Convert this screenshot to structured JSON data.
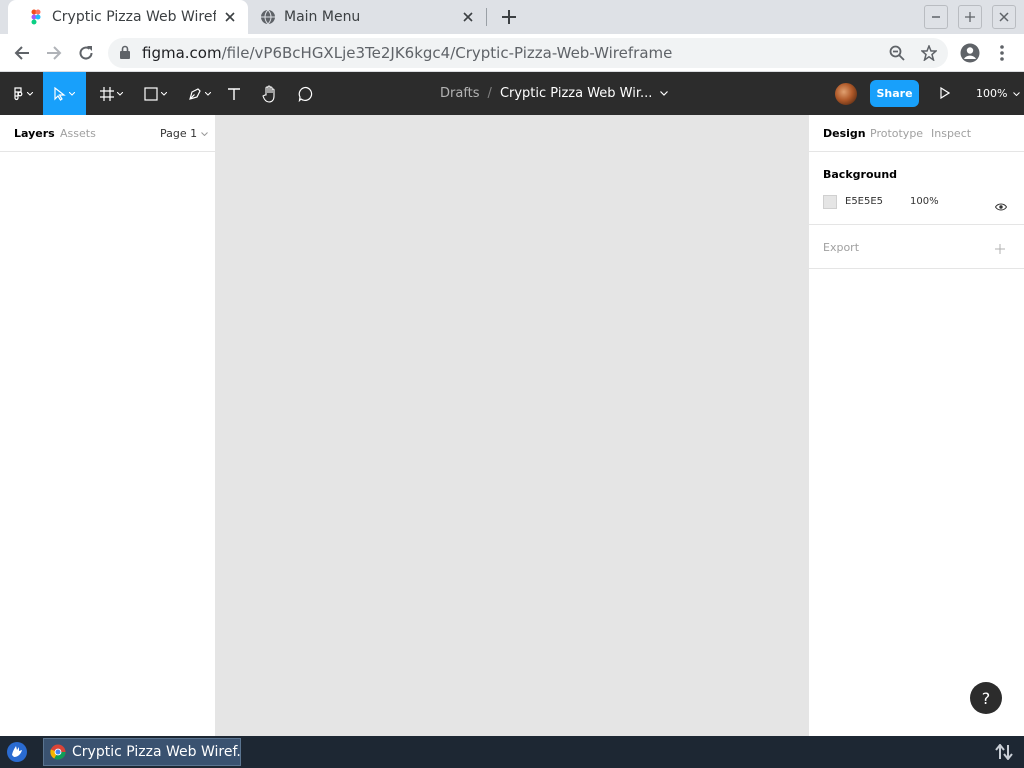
{
  "browser": {
    "tabs": [
      {
        "title": "Cryptic Pizza Web Wireframe",
        "favicon": "figma-icon",
        "active": true
      },
      {
        "title": "Main Menu",
        "favicon": "globe-icon",
        "active": false
      }
    ],
    "url_domain": "figma.com",
    "url_path": "/file/vP6BcHGXLje3Te2JK6kgc4/Cryptic-Pizza-Web-Wireframe"
  },
  "figma": {
    "breadcrumb": {
      "folder": "Drafts",
      "separator": "/",
      "file": "Cryptic Pizza Web Wir..."
    },
    "share_label": "Share",
    "zoom": "100%",
    "left_panel": {
      "tabs": [
        "Layers",
        "Assets"
      ],
      "page": "Page 1"
    },
    "right_panel": {
      "tabs": [
        "Design",
        "Prototype",
        "Inspect"
      ],
      "background": {
        "title": "Background",
        "hex": "E5E5E5",
        "opacity": "100%"
      },
      "export": {
        "title": "Export"
      }
    },
    "help_label": "?",
    "colors": {
      "toolbar": "#2c2c2c",
      "accent": "#18a0fb",
      "canvas": "#e5e5e5"
    }
  },
  "taskbar": {
    "item_title": "Cryptic Pizza Web Wiref..."
  }
}
